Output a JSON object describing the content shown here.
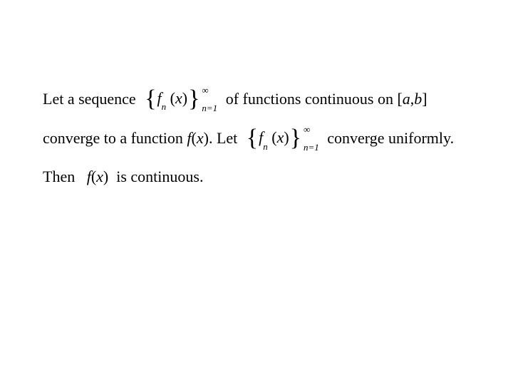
{
  "line1": {
    "t1": "Let a sequence ",
    "seq": {
      "fn": "f",
      "sub": "n",
      "arg": "x",
      "lower": "n=1",
      "upper": "∞"
    },
    "t2": " of functions continuous on [",
    "a": "a",
    "comma": ",",
    "b": "b",
    "t3": "]"
  },
  "line2": {
    "t1": "converge to a function ",
    "f": "f ",
    "t2": "(",
    "x": "x",
    "t3": "). Let ",
    "seq": {
      "fn": "f",
      "sub": "n",
      "arg": "x",
      "lower": "n=1",
      "upper": "∞"
    },
    "t4": " converge uniformly."
  },
  "line3": {
    "t1": "Then   ",
    "f": "f ",
    "t2": "(",
    "x": "x",
    "t3": ")  is continuous."
  }
}
